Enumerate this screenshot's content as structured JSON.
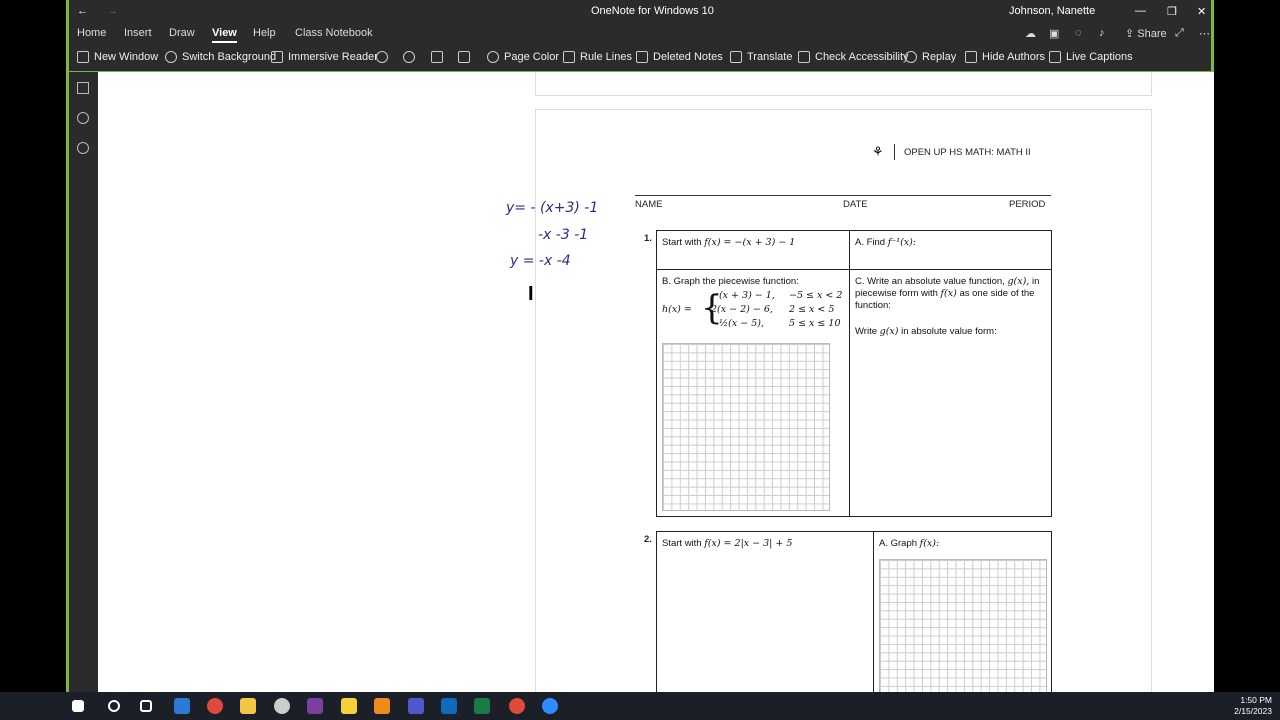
{
  "window": {
    "title": "OneNote for Windows 10",
    "user": "Johnson, Nanette",
    "share_label": "Share"
  },
  "menu": [
    "Home",
    "Insert",
    "Draw",
    "View",
    "Help",
    "Class Notebook"
  ],
  "menu_active": "View",
  "ribbon": {
    "new_window": "New Window",
    "switch_background": "Switch Background",
    "immersive_reader": "Immersive Reader",
    "page_color": "Page Color",
    "rule_lines": "Rule Lines",
    "deleted_notes": "Deleted Notes",
    "translate": "Translate",
    "check_accessibility": "Check Accessibility",
    "replay": "Replay",
    "hide_authors": "Hide Authors",
    "live_captions": "Live Captions"
  },
  "worksheet": {
    "header": "OPEN UP HS MATH: MATH II",
    "name_label": "NAME",
    "date_label": "DATE",
    "period_label": "PERIOD",
    "q1_number": "1.",
    "q1_start": "Start with",
    "q1_func": "f(x) = −(x + 3) − 1",
    "q1_a": "A. Find",
    "q1_a_math": "f⁻¹(x):",
    "q1_b": "B. Graph the piecewise function:",
    "q1_b_lhs": "h(x) =",
    "q1_b_rows": [
      {
        "expr": "−(x + 3) − 1,",
        "cond": "−5 ≤ x < 2"
      },
      {
        "expr": "2(x − 2) − 6,",
        "cond": "2 ≤ x < 5"
      },
      {
        "expr": "−½(x − 5),",
        "cond": "5 ≤ x ≤ 10"
      }
    ],
    "q1_c_pre": "C. Write an absolute value function,",
    "q1_c_g": "g(x),",
    "q1_c_in": "in",
    "q1_c_mid": "piecewise form with",
    "q1_c_f": "f(x)",
    "q1_c_post": "as one side of the",
    "q1_c_end": "function:",
    "q1_c2_pre": "Write",
    "q1_c2_g": "g(x)",
    "q1_c2_post": "in absolute value form:",
    "q2_number": "2.",
    "q2_start": "Start with",
    "q2_func": "f(x) = 2|x − 3| + 5",
    "q2_a": "A. Graph",
    "q2_a_math": "f(x):"
  },
  "handwriting": {
    "line1": "y= - (x+3) -1",
    "line2": "-x -3 -1",
    "line3": "y = -x -4"
  },
  "tray": {
    "time": "1:50 PM",
    "date": "2/15/2023"
  }
}
